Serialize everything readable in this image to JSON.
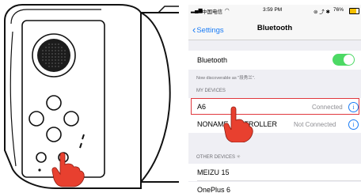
{
  "status_bar": {
    "carrier": "中国电信",
    "time": "3:59 PM",
    "battery": "76%",
    "battery_level": 0.76
  },
  "navigation": {
    "back_label": "Settings",
    "title": "Bluetooth"
  },
  "bluetooth_row": {
    "label": "Bluetooth",
    "enabled": true
  },
  "discoverable_note": "Now discoverable as \"段秀兰\".",
  "my_devices": {
    "header": "MY DEVICES",
    "items": [
      {
        "name": "A6",
        "status": "Connected",
        "highlighted": true
      },
      {
        "name": "NONAME",
        "name_tail": "TROLLER",
        "status": "Not Connected",
        "highlighted": false
      }
    ]
  },
  "other_devices": {
    "header": "OTHER DEVICES",
    "items": [
      {
        "name": "MEIZU 15"
      },
      {
        "name": "OnePlus 6"
      }
    ]
  },
  "colors": {
    "accent": "#1a7cf5",
    "toggle_on": "#4cd964",
    "highlight_border": "#e0383e",
    "hand_fill": "#e8402f"
  }
}
